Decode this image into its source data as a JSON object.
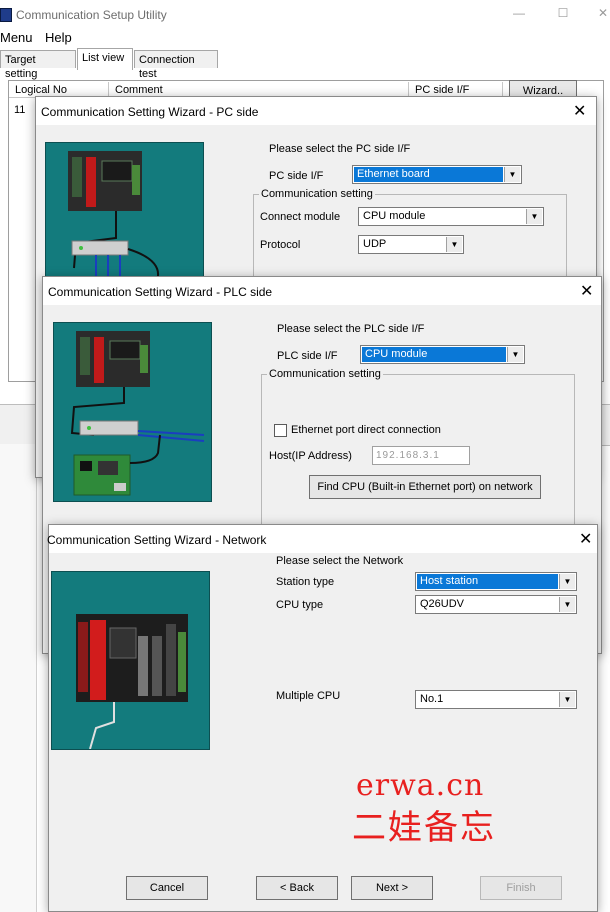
{
  "app": {
    "title": "Communication Setup Utility",
    "window_controls": [
      "—",
      "☐",
      "✕"
    ]
  },
  "menu": {
    "items": [
      "Menu",
      "Help"
    ]
  },
  "tabs": [
    "Target setting",
    "List view",
    "Connection test"
  ],
  "list": {
    "columns": [
      "Logical No",
      "Comment",
      "PC side I/F"
    ],
    "rows": [
      {
        "logical_no": "11"
      }
    ],
    "wizard_button": "Wizard.."
  },
  "dialog_pc": {
    "title": "Communication Setting Wizard - PC side",
    "prompt": "Please select the PC side I/F",
    "pc_side_if_label": "PC side I/F",
    "pc_side_if_value": "Ethernet board",
    "group_label": "Communication setting",
    "connect_module_label": "Connect module",
    "connect_module_value": "CPU module",
    "protocol_label": "Protocol",
    "protocol_value": "UDP"
  },
  "dialog_plc": {
    "title": "Communication Setting Wizard - PLC side",
    "prompt": "Please select the PLC side I/F",
    "plc_side_if_label": "PLC side I/F",
    "plc_side_if_value": "CPU module",
    "group_label": "Communication setting",
    "direct_connection_label": "Ethernet port direct connection",
    "direct_connection_checked": false,
    "host_label": "Host(IP Address)",
    "host_value": "192.168.3.1",
    "find_cpu_button": "Find CPU (Built-in Ethernet port) on network"
  },
  "dialog_network": {
    "title": "Communication Setting Wizard - Network",
    "prompt": "Please select the Network",
    "station_type_label": "Station type",
    "station_type_value": "Host station",
    "cpu_type_label": "CPU type",
    "cpu_type_value": "Q26UDV",
    "multiple_cpu_label": "Multiple CPU",
    "multiple_cpu_value": "No.1",
    "buttons": {
      "cancel": "Cancel",
      "back": "< Back",
      "next": "Next >",
      "finish": "Finish"
    }
  },
  "watermark": {
    "domain": "erwa.cn",
    "chinese": "二娃备忘"
  },
  "colors": {
    "teal_bg": "#137b7d",
    "selection": "#0a78d7",
    "watermark": "#e8201f"
  }
}
